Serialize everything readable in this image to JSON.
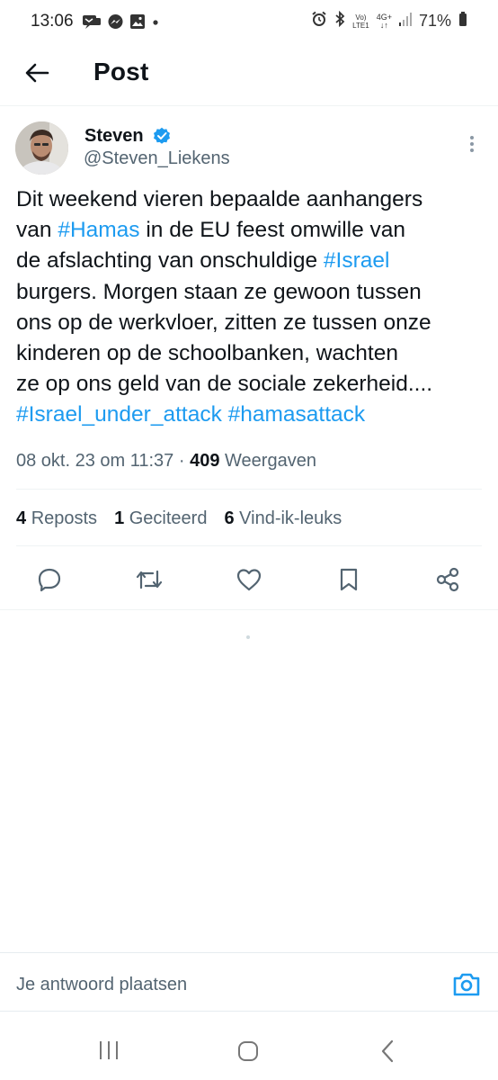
{
  "status_bar": {
    "time": "13:06",
    "battery_percent": "71%",
    "network_volte": "Vo)",
    "network_lte": "LTE1",
    "network_gen": "4G+",
    "notification_icons": [
      "chat-icon",
      "messenger-icon",
      "gallery-icon",
      "dot-icon"
    ],
    "system_icons": [
      "alarm-icon",
      "bluetooth-icon",
      "signal-icon",
      "battery-icon"
    ]
  },
  "header": {
    "title": "Post"
  },
  "post": {
    "author_name": "Steven",
    "author_handle": "@Steven_Liekens",
    "verified": true,
    "text_lines": [
      [
        {
          "t": "Dit weekend vieren bepaalde aanhangers",
          "tag": false
        }
      ],
      [
        {
          "t": "van ",
          "tag": false
        },
        {
          "t": "#Hamas",
          "tag": true
        },
        {
          "t": " in de EU feest omwille van",
          "tag": false
        }
      ],
      [
        {
          "t": "de afslachting van onschuldige ",
          "tag": false
        },
        {
          "t": "#Israel",
          "tag": true
        }
      ],
      [
        {
          "t": "burgers. Morgen staan ze gewoon tussen",
          "tag": false
        }
      ],
      [
        {
          "t": "ons op de werkvloer, zitten ze tussen onze",
          "tag": false
        }
      ],
      [
        {
          "t": "kinderen op de schoolbanken, wachten",
          "tag": false
        }
      ],
      [
        {
          "t": "ze op ons geld van de sociale zekerheid....",
          "tag": false
        }
      ],
      [
        {
          "t": "#Israel_under_attack",
          "tag": true
        },
        {
          "t": " ",
          "tag": false
        },
        {
          "t": "#hamasattack",
          "tag": true
        }
      ]
    ],
    "timestamp": "08 okt. 23 om 11:37",
    "separator": " · ",
    "views_count": "409",
    "views_label": "Weergaven"
  },
  "stats": {
    "reposts_count": "4",
    "reposts_label": "Reposts",
    "quotes_count": "1",
    "quotes_label": "Geciteerd",
    "likes_count": "6",
    "likes_label": "Vind-ik-leuks"
  },
  "actions": [
    "reply-icon",
    "repost-icon",
    "like-icon",
    "bookmark-icon",
    "share-icon"
  ],
  "reply": {
    "placeholder": "Je antwoord plaatsen"
  },
  "colors": {
    "accent": "#1d9bf0",
    "text": "#0f1419",
    "secondary": "#536471",
    "divider": "#eff3f4"
  }
}
